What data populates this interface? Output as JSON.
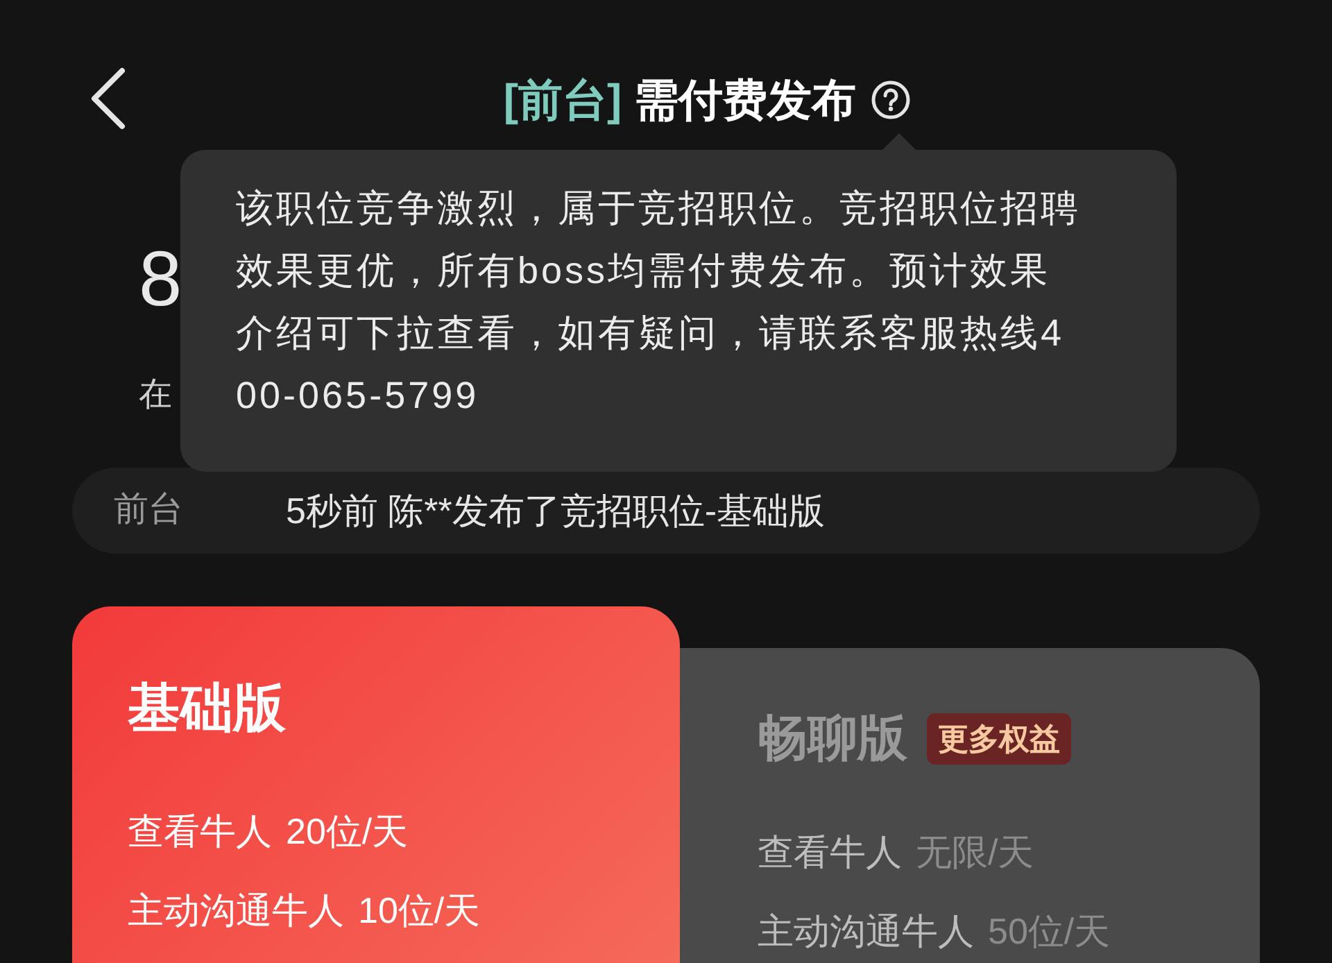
{
  "header": {
    "tag": "[前台]",
    "title": "需付费发布"
  },
  "tooltip": {
    "text": "该职位竞争激烈，属于竞招职位。竞招职位招聘效果更优，所有boss均需付费发布。预计效果介绍可下拉查看，如有疑问，请联系客服热线400-065-5799"
  },
  "covered_fragments": {
    "number": "8",
    "line": "在"
  },
  "notice_bar": {
    "label": "前台",
    "message": "5秒前 陈**发布了竞招职位-基础版"
  },
  "plans": [
    {
      "name": "基础版",
      "selected": true,
      "features": [
        {
          "label": "查看牛人",
          "value": "20位/天"
        },
        {
          "label": "主动沟通牛人",
          "value": "10位/天"
        }
      ]
    },
    {
      "name": "畅聊版",
      "selected": false,
      "badge": "更多权益",
      "features": [
        {
          "label": "查看牛人",
          "value": "无限/天"
        },
        {
          "label": "主动沟通牛人",
          "value": "50位/天"
        }
      ]
    }
  ]
}
